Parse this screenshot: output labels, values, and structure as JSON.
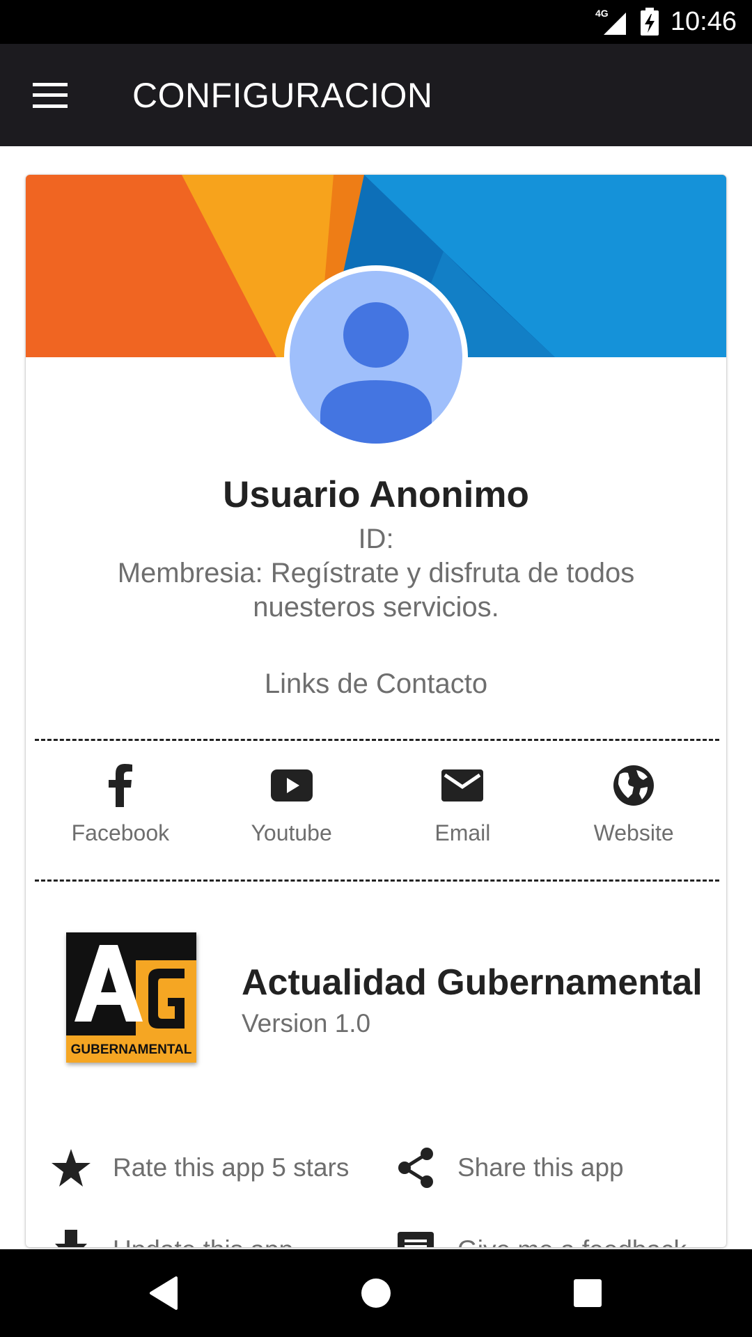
{
  "status_bar": {
    "network_label": "4G",
    "time": "10:46",
    "network_icon": "signal-4g-icon",
    "battery_icon": "battery-charging-icon"
  },
  "app_bar": {
    "title": "CONFIGURACION",
    "menu_icon": "menu-icon",
    "background": "#1c1b1f"
  },
  "profile": {
    "name": "Usuario Anonimo",
    "id_line": "ID:",
    "membership_line": "Membresia: Regístrate y disfruta de todos nuesteros servicios.",
    "avatar_icon": "person-avatar-icon"
  },
  "contact": {
    "title": "Links de Contacto",
    "links": [
      {
        "label": "Facebook",
        "icon": "facebook-icon"
      },
      {
        "label": "Youtube",
        "icon": "youtube-icon"
      },
      {
        "label": "Email",
        "icon": "email-icon"
      },
      {
        "label": "Website",
        "icon": "globe-icon"
      }
    ]
  },
  "app_info": {
    "name": "Actualidad Gubernamental",
    "version": "Version 1.0",
    "logo": {
      "letters": "AG",
      "caption": "GUBERNAMENTAL"
    }
  },
  "actions": [
    {
      "label": "Rate this app 5 stars",
      "icon": "star-icon"
    },
    {
      "label": "Share this app",
      "icon": "share-icon"
    },
    {
      "label": "Update this app",
      "icon": "download-icon"
    },
    {
      "label": "Give me a feedback",
      "icon": "feedback-icon"
    }
  ],
  "nav_bar": {
    "back_icon": "back-icon",
    "home_icon": "home-icon",
    "recents_icon": "recents-icon"
  },
  "colors": {
    "banner_orange": "#f06522",
    "banner_yellow": "#f7a31c",
    "banner_blue": "#1592d9",
    "avatar_bg": "#9fbffb",
    "avatar_fg": "#4475e1",
    "logo_orange": "#f5a623"
  }
}
